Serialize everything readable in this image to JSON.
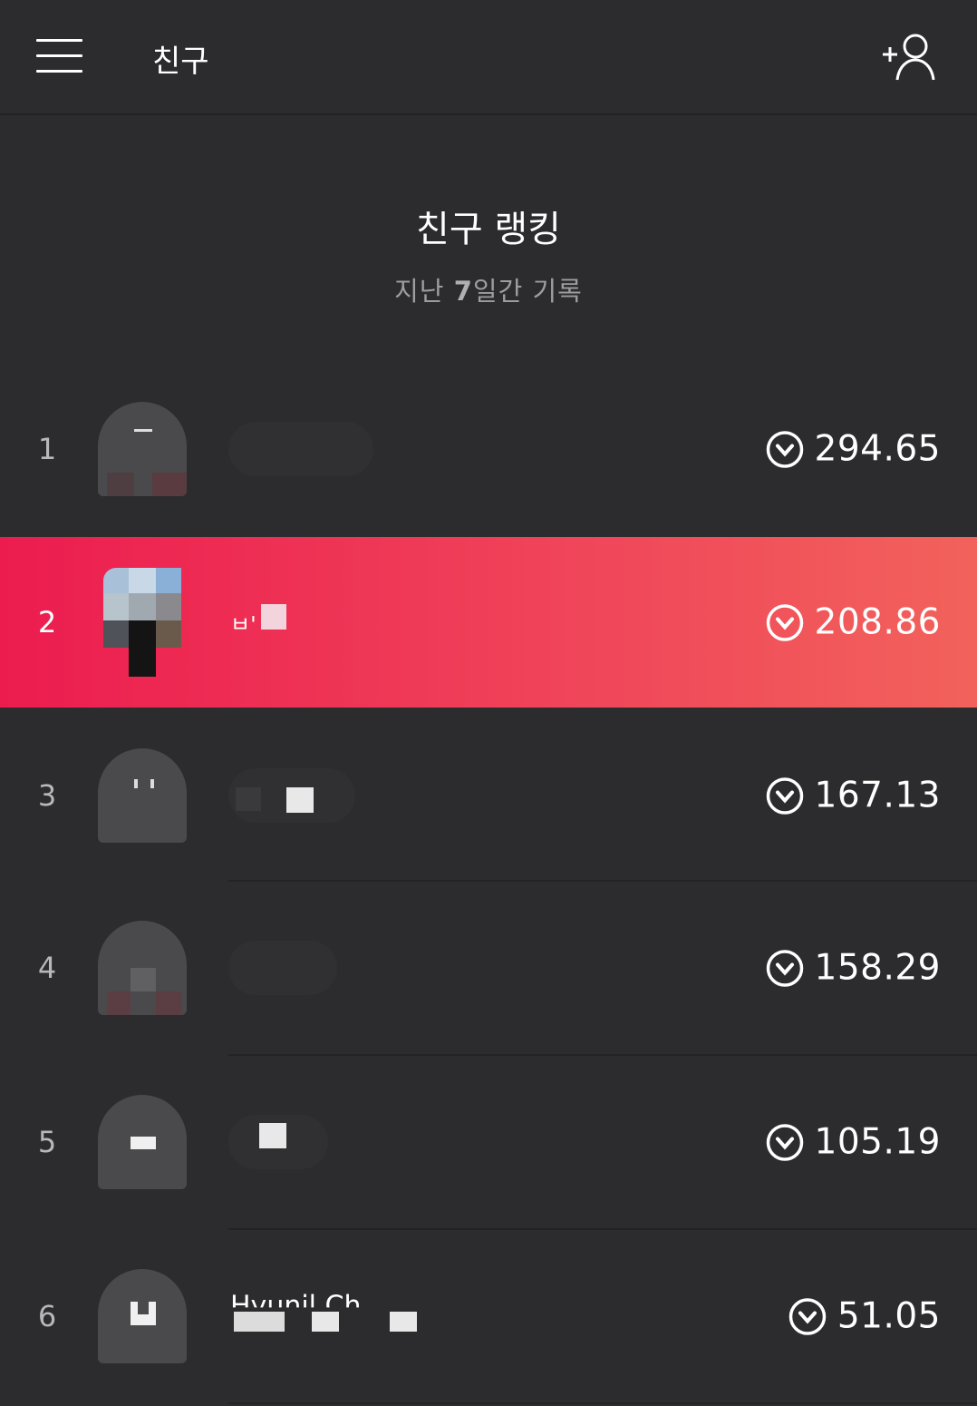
{
  "header": {
    "title": "친구",
    "menu_icon": "hamburger-menu-icon",
    "add_friend_icon": "add-friend-icon"
  },
  "ranking": {
    "title": "친구 랭킹",
    "subtitle_prefix": "지난 ",
    "subtitle_days": "7",
    "subtitle_suffix": "일간 기록"
  },
  "colors": {
    "background": "#2c2c2e",
    "highlight_start": "#ec1c4f",
    "highlight_end": "#f2625b",
    "rank_text": "#b8b8ba"
  },
  "friends": [
    {
      "rank": "1",
      "name": "",
      "score": "294.65",
      "highlighted": false
    },
    {
      "rank": "2",
      "name": "ㅂ'",
      "score": "208.86",
      "highlighted": true
    },
    {
      "rank": "3",
      "name": "",
      "score": "167.13",
      "highlighted": false
    },
    {
      "rank": "4",
      "name": "",
      "score": "158.29",
      "highlighted": false
    },
    {
      "rank": "5",
      "name": "",
      "score": "105.19",
      "highlighted": false
    },
    {
      "rank": "6",
      "name": "Hyunil Ch",
      "score": "51.05",
      "highlighted": false
    }
  ],
  "score_icon": "chevron-down-circle-icon"
}
